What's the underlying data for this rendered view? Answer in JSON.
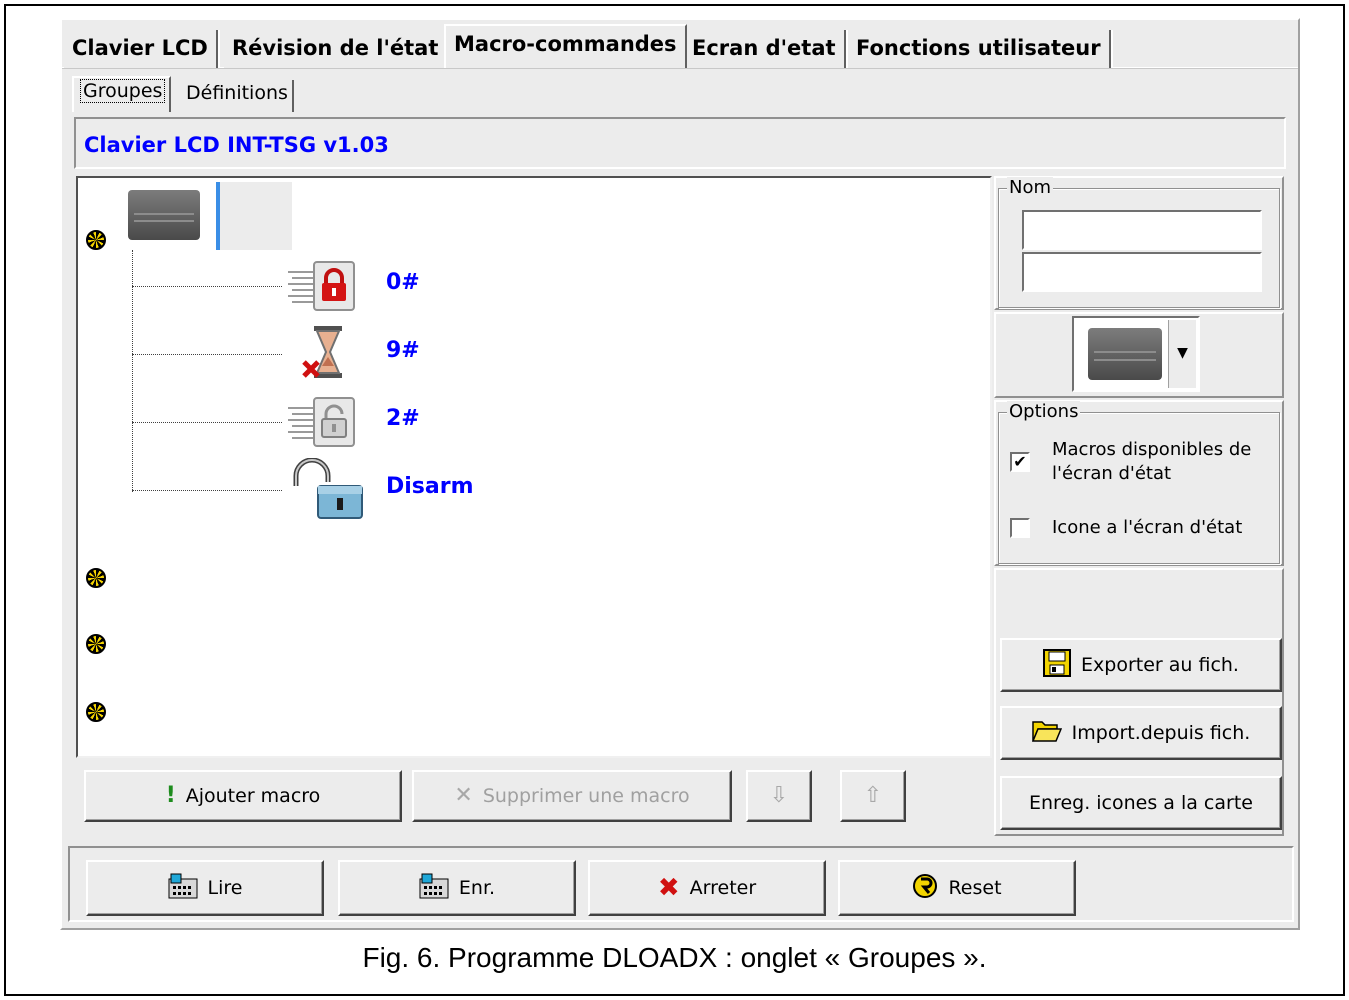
{
  "main_tabs": [
    "Clavier LCD",
    "Révision de l'état",
    "Macro-commandes",
    "Ecran d'etat",
    "Fonctions utilisateur"
  ],
  "active_main_tab": "Macro-commandes",
  "sub_tabs": [
    "Groupes",
    "Définitions"
  ],
  "active_sub_tab": "Groupes",
  "device_title": "Clavier LCD INT-TSG v1.03",
  "tree": {
    "macros": [
      {
        "label": "0#",
        "icon": "lock-red-icon"
      },
      {
        "label": "9#",
        "icon": "hourglass-cancel-icon"
      },
      {
        "label": "2#",
        "icon": "lock-gray-icon"
      },
      {
        "label": "Disarm",
        "icon": "padlock-open-icon"
      }
    ]
  },
  "buttons": {
    "add_macro": "Ajouter macro",
    "delete_macro": "Supprimer une macro",
    "export": "Exporter au fich.",
    "import": "Import.depuis fich.",
    "save_icons": "Enreg. icones a la carte",
    "read": "Lire",
    "write": "Enr.",
    "stop": "Arreter",
    "reset": "Reset"
  },
  "name_group": {
    "title": "Nom",
    "field1": "",
    "field2": ""
  },
  "options": {
    "title": "Options",
    "items": [
      {
        "label": "Macros disponibles de l'écran d'état",
        "checked": true
      },
      {
        "label": "Icone a l'écran d'état",
        "checked": false
      }
    ]
  },
  "caption": "Fig. 6. Programme DLOADX : onglet « Groupes »."
}
